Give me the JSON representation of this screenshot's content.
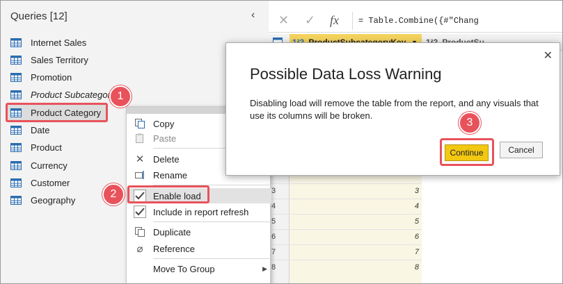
{
  "queries": {
    "header": "Queries [12]",
    "collapse_icon": "‹",
    "items": [
      {
        "label": "Internet Sales"
      },
      {
        "label": "Sales Territory"
      },
      {
        "label": "Promotion"
      },
      {
        "label": "Product Subcategory"
      },
      {
        "label": "Product Category"
      },
      {
        "label": "Date"
      },
      {
        "label": "Product"
      },
      {
        "label": "Currency"
      },
      {
        "label": "Customer"
      },
      {
        "label": "Geography"
      }
    ]
  },
  "formula_bar": {
    "cancel_icon": "✕",
    "commit_icon": "✓",
    "fx_icon": "fx",
    "formula": "= Table.Combine({#\"Chang"
  },
  "grid": {
    "active_column": "ProductSubcategoryKey",
    "next_column": "ProductSu",
    "type_icon": "1²3",
    "rows": [
      {
        "num": "3",
        "val": "3"
      },
      {
        "num": "4",
        "val": "4"
      },
      {
        "num": "5",
        "val": "5"
      },
      {
        "num": "6",
        "val": "6"
      },
      {
        "num": "7",
        "val": "7"
      },
      {
        "num": "8",
        "val": "8"
      }
    ]
  },
  "context_menu": {
    "copy": "Copy",
    "paste": "Paste",
    "delete": "Delete",
    "rename": "Rename",
    "enable_load": "Enable load",
    "include_refresh": "Include in report refresh",
    "duplicate": "Duplicate",
    "reference": "Reference",
    "move_to_group": "Move To Group"
  },
  "dialog": {
    "title": "Possible Data Loss Warning",
    "message": "Disabling load will remove the table from the report, and any visuals that use its columns will be broken.",
    "continue": "Continue",
    "cancel": "Cancel",
    "close_icon": "✕"
  },
  "badges": [
    "1",
    "2",
    "3"
  ],
  "colors": {
    "accent_red": "#e8525b",
    "continue_yellow": "#f2c811",
    "column_highlight": "#f4d35e"
  }
}
